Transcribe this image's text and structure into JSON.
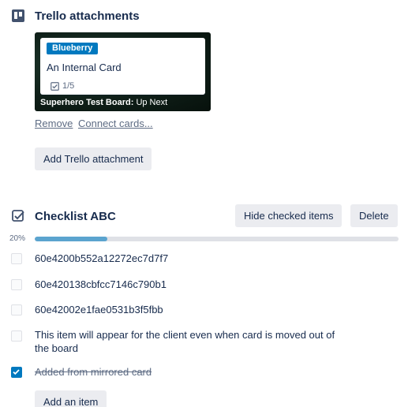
{
  "attachments": {
    "title": "Trello attachments",
    "card": {
      "label": "Blueberry",
      "label_color": "#0079bf",
      "name": "An Internal Card",
      "checklist_badge": "1/5",
      "board_name": "Superhero Test Board:",
      "list_name": "Up Next"
    },
    "remove_label": "Remove",
    "connect_label": "Connect cards...",
    "add_button": "Add Trello attachment"
  },
  "checklist": {
    "title": "Checklist ABC",
    "hide_checked_button": "Hide checked items",
    "delete_button": "Delete",
    "progress_label": "20%",
    "progress_fraction": 0.2,
    "progress_color": "#5ba4cf",
    "items": [
      {
        "text": "60e4200b552a12272ec7d7f7",
        "checked": false
      },
      {
        "text": "60e420138cbfcc7146c790b1",
        "checked": false
      },
      {
        "text": "60e42002e1fae0531b3f5fbb",
        "checked": false
      },
      {
        "text": "This item will appear for the client even when card is moved out of the board",
        "checked": false
      },
      {
        "text": "Added from mirrored card",
        "checked": true
      }
    ],
    "add_item_button": "Add an item"
  }
}
